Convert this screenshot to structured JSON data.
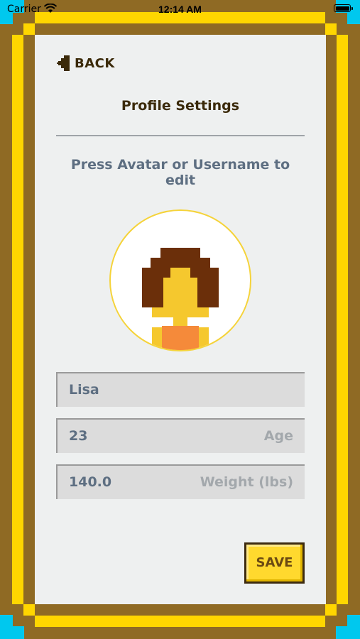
{
  "status_bar": {
    "carrier": "Carrier",
    "time": "12:14 AM",
    "wifi_icon": "wifi-icon",
    "battery_icon": "battery-icon"
  },
  "header": {
    "back_label": "BACK",
    "back_icon": "back-arrow-icon",
    "title": "Profile Settings"
  },
  "hint": "Press Avatar or Username to edit",
  "avatar": {
    "icon": "pixel-avatar-girl-icon",
    "border_color": "#f5d33a"
  },
  "form": {
    "username": {
      "value": "Lisa",
      "placeholder": ""
    },
    "age": {
      "value": "23",
      "placeholder": "Age"
    },
    "weight": {
      "value": "140.0",
      "placeholder": "Weight (lbs)"
    }
  },
  "save_label": "SAVE",
  "colors": {
    "frame_brown": "#8f6a24",
    "frame_yellow": "#ffd600",
    "frame_cyan": "#00c8ee",
    "panel": "#eef0f0",
    "title_text": "#3b2a0a",
    "hint_text": "#5e6f82",
    "save_button": "#ffd92e"
  }
}
